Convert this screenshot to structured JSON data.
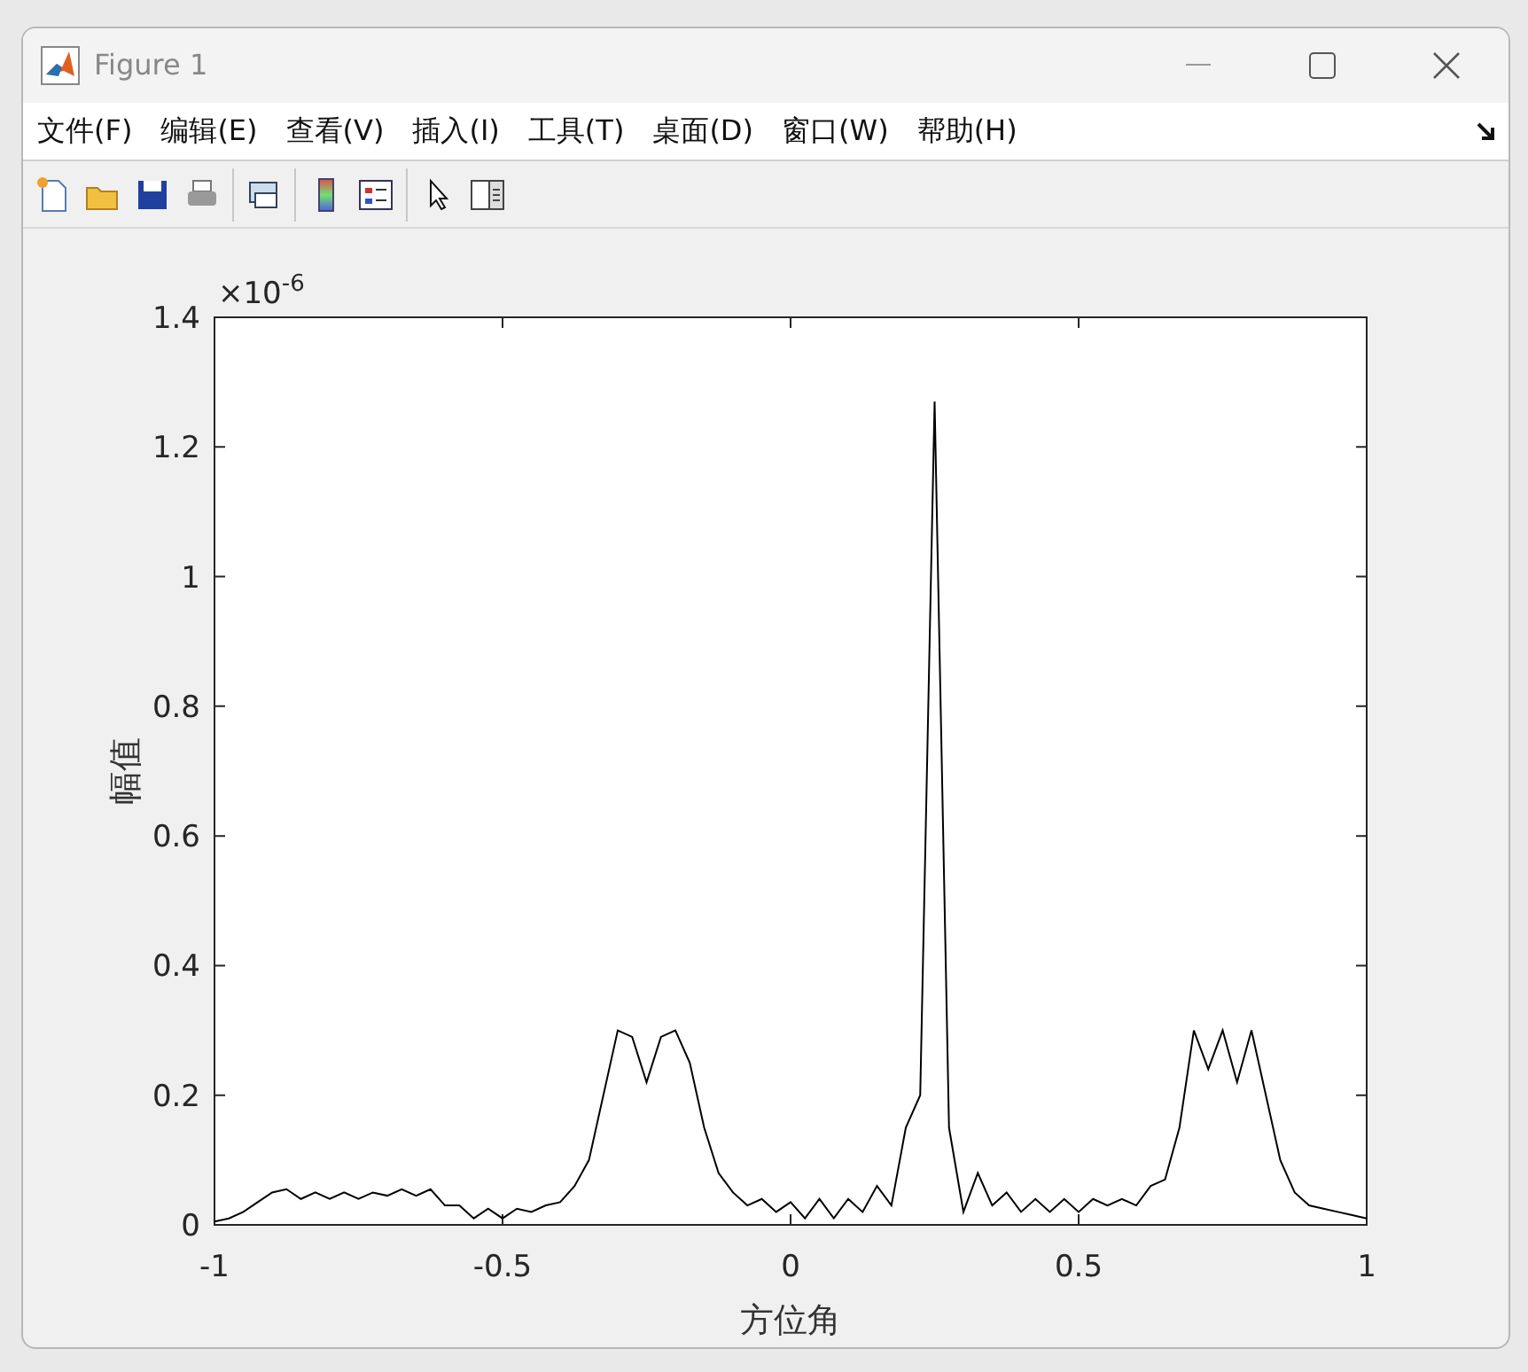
{
  "window": {
    "title": "Figure 1"
  },
  "menu": [
    "文件(F)",
    "编辑(E)",
    "查看(V)",
    "插入(I)",
    "工具(T)",
    "桌面(D)",
    "窗口(W)",
    "帮助(H)"
  ],
  "figure": {
    "exponent": "×10$^{-6}$",
    "chart_data": {
      "type": "line",
      "xlabel": "方位角",
      "ylabel": "幅值",
      "xlim": [
        -1,
        1
      ],
      "ylim": [
        0,
        1.4
      ],
      "xticks": [
        {
          "value": -1,
          "label": "-1"
        },
        {
          "value": -0.5,
          "label": "-0.5"
        },
        {
          "value": 0,
          "label": "0"
        },
        {
          "value": 0.5,
          "label": "0.5"
        },
        {
          "value": 1,
          "label": "1"
        }
      ],
      "yticks": [
        {
          "value": 0,
          "label": "0"
        },
        {
          "value": 0.2,
          "label": "0.2"
        },
        {
          "value": 0.4,
          "label": "0.4"
        },
        {
          "value": 0.6,
          "label": "0.6"
        },
        {
          "value": 0.8,
          "label": "0.8"
        },
        {
          "value": 1,
          "label": "1"
        },
        {
          "value": 1.2,
          "label": "1.2"
        },
        {
          "value": 1.4,
          "label": "1.4"
        }
      ],
      "x": [
        -1,
        -0.975,
        -0.95,
        -0.925,
        -0.9,
        -0.875,
        -0.85,
        -0.825,
        -0.8,
        -0.775,
        -0.75,
        -0.725,
        -0.7,
        -0.675,
        -0.65,
        -0.625,
        -0.6,
        -0.575,
        -0.55,
        -0.525,
        -0.5,
        -0.475,
        -0.45,
        -0.425,
        -0.4,
        -0.375,
        -0.35,
        -0.325,
        -0.3,
        -0.275,
        -0.25,
        -0.225,
        -0.2,
        -0.175,
        -0.15,
        -0.125,
        -0.1,
        -0.075,
        -0.05,
        -0.025,
        0,
        0.025,
        0.05,
        0.075,
        0.1,
        0.125,
        0.15,
        0.175,
        0.2,
        0.225,
        0.25,
        0.275,
        0.3,
        0.325,
        0.35,
        0.375,
        0.4,
        0.425,
        0.45,
        0.475,
        0.5,
        0.525,
        0.55,
        0.575,
        0.6,
        0.625,
        0.65,
        0.675,
        0.7,
        0.725,
        0.75,
        0.775,
        0.8,
        0.825,
        0.85,
        0.875,
        0.9,
        0.925,
        0.95,
        0.975,
        1
      ],
      "series": [
        {
          "color": "#000000",
          "values": [
            0.005,
            0.01,
            0.02,
            0.035,
            0.05,
            0.055,
            0.04,
            0.05,
            0.04,
            0.05,
            0.04,
            0.05,
            0.045,
            0.055,
            0.045,
            0.055,
            0.03,
            0.03,
            0.01,
            0.025,
            0.01,
            0.025,
            0.02,
            0.03,
            0.035,
            0.06,
            0.1,
            0.2,
            0.3,
            0.29,
            0.22,
            0.29,
            0.3,
            0.25,
            0.15,
            0.08,
            0.05,
            0.03,
            0.04,
            0.02,
            0.035,
            0.01,
            0.04,
            0.01,
            0.04,
            0.02,
            0.06,
            0.03,
            0.15,
            0.2,
            1.27,
            0.15,
            0.02,
            0.08,
            0.03,
            0.05,
            0.02,
            0.04,
            0.02,
            0.04,
            0.02,
            0.04,
            0.03,
            0.04,
            0.03,
            0.06,
            0.07,
            0.15,
            0.3,
            0.24,
            0.3,
            0.22,
            0.3,
            0.2,
            0.1,
            0.05,
            0.03,
            0.025,
            0.02,
            0.015,
            0.01
          ]
        }
      ]
    }
  }
}
